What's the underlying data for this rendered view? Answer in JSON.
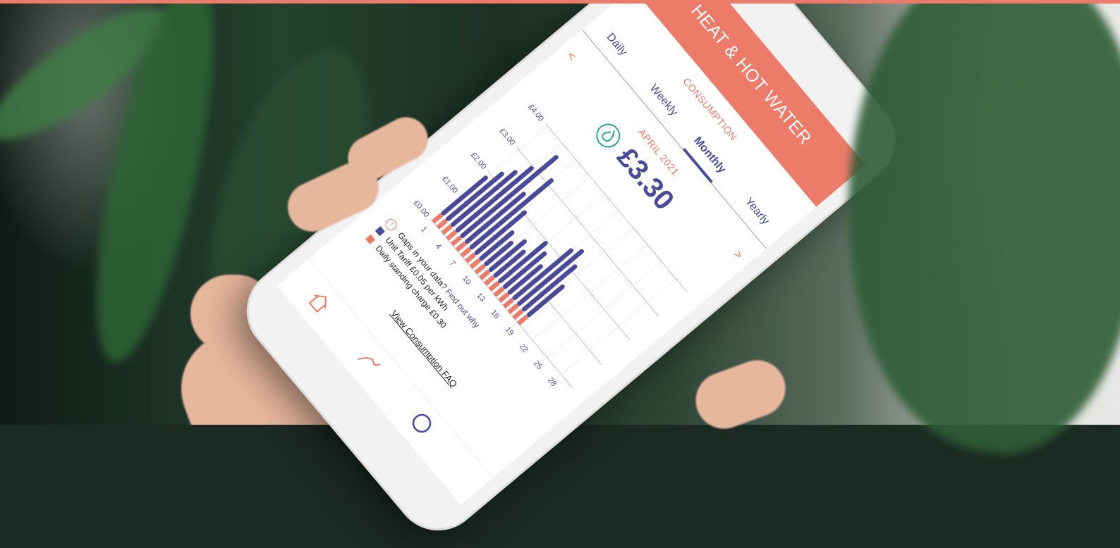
{
  "app": {
    "title": "HEAT & HOT WATER",
    "subtitle": "CONSUMPTION"
  },
  "tabs": [
    {
      "label": "Daily"
    },
    {
      "label": "Weekly"
    },
    {
      "label": "Monthly",
      "active": true
    },
    {
      "label": "Yearly"
    }
  ],
  "nav": {
    "prev": "<",
    "next": ">"
  },
  "summary": {
    "period": "APRIL 2021",
    "amount": "£3.30",
    "icon": "flame-icon"
  },
  "legend": {
    "gaps_text": "Gaps in your data?",
    "gaps_link": "Find out why",
    "unit_tariff": "Unit Tariff £0.05 per kWh",
    "standing_charge": "Daily standing charge £0.30"
  },
  "faq_link": "View Consumption FAQ",
  "colors": {
    "accent": "#ec7b6a",
    "primary": "#4a4a9a",
    "standing": "#ec7b6a",
    "tariff": "#4a4a9a"
  },
  "chart_data": {
    "type": "bar",
    "stacked": true,
    "y_ticks": [
      "£0.00",
      "£1.00",
      "£2.00",
      "£3.00",
      "£4.00"
    ],
    "ylim": [
      0,
      4
    ],
    "x_ticks": [
      "1",
      "4",
      "7",
      "10",
      "13",
      "16",
      "19",
      "22",
      "25",
      "28"
    ],
    "categories": [
      "1",
      "2",
      "3",
      "4",
      "5",
      "6",
      "7",
      "8",
      "9",
      "10",
      "11",
      "12",
      "13",
      "14",
      "15",
      "16",
      "17",
      "18",
      "19",
      "20",
      "21",
      "22",
      "23",
      "24",
      "25",
      "26",
      "27",
      "28",
      "29",
      "30"
    ],
    "series": [
      {
        "name": "Unit Tariff £0.05 per kWh",
        "values": [
          1.6,
          2.0,
          2.3,
          2.7,
          3.4,
          2.1,
          2.9,
          1.8,
          1.2,
          1.0,
          1.3,
          1.1,
          1.7,
          1.5,
          1.2,
          2.1,
          2.3,
          1.9,
          1.3,
          0,
          0,
          0,
          0,
          0,
          0,
          0,
          0,
          0,
          0,
          0
        ]
      },
      {
        "name": "Daily standing charge £0.30",
        "values": [
          0.3,
          0.3,
          0.3,
          0.3,
          0.3,
          0.3,
          0.3,
          0.3,
          0.3,
          0.3,
          0.3,
          0.3,
          0.3,
          0.3,
          0.3,
          0.3,
          0.3,
          0.3,
          0.3,
          0,
          0,
          0,
          0,
          0,
          0,
          0,
          0,
          0,
          0,
          0
        ]
      }
    ]
  }
}
